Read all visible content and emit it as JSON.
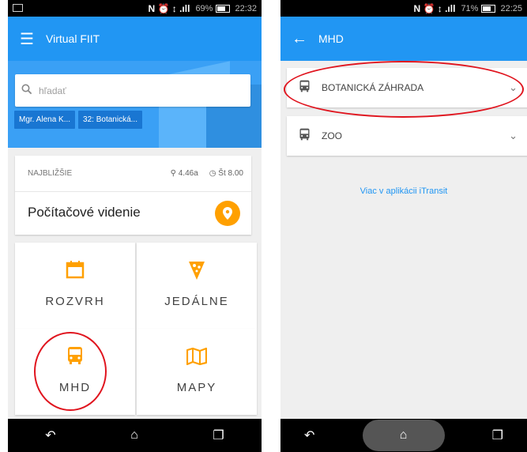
{
  "left": {
    "status": {
      "icons": "N ⏰ ↕ .ıll",
      "battery": "69%",
      "time": "22:32"
    },
    "appbar": {
      "title": "Virtual FIIT"
    },
    "search": {
      "placeholder": "hľadať"
    },
    "chips": [
      "Mgr. Alena K...",
      "32: Botanická..."
    ],
    "next": {
      "label": "NAJBLIŽŠIE",
      "location": "4.46a",
      "time": "Št 8.00",
      "title": "Počítačové videnie"
    },
    "tiles": {
      "rozvrh": "ROZVRH",
      "jedalne": "JEDÁLNE",
      "mhd": "MHD",
      "mapy": "MAPY"
    }
  },
  "right": {
    "status": {
      "icons": "N ⏰ ↕ .ıll",
      "battery": "71%",
      "time": "22:25"
    },
    "appbar": {
      "title": "MHD"
    },
    "routes": [
      "BOTANICKÁ ZÁHRADA",
      "ZOO"
    ],
    "link": "Viac v aplikácii iTransit"
  },
  "colors": {
    "primary": "#2196f3",
    "accent": "#ffa000",
    "annotation": "#e0141e"
  },
  "icons": [
    "menu-icon",
    "search-icon",
    "pin-icon",
    "clock-icon",
    "calendar-icon",
    "pizza-icon",
    "bus-icon",
    "map-icon",
    "back-icon",
    "chevron-down-icon",
    "home-icon",
    "recents-icon",
    "back-arrow-icon"
  ]
}
